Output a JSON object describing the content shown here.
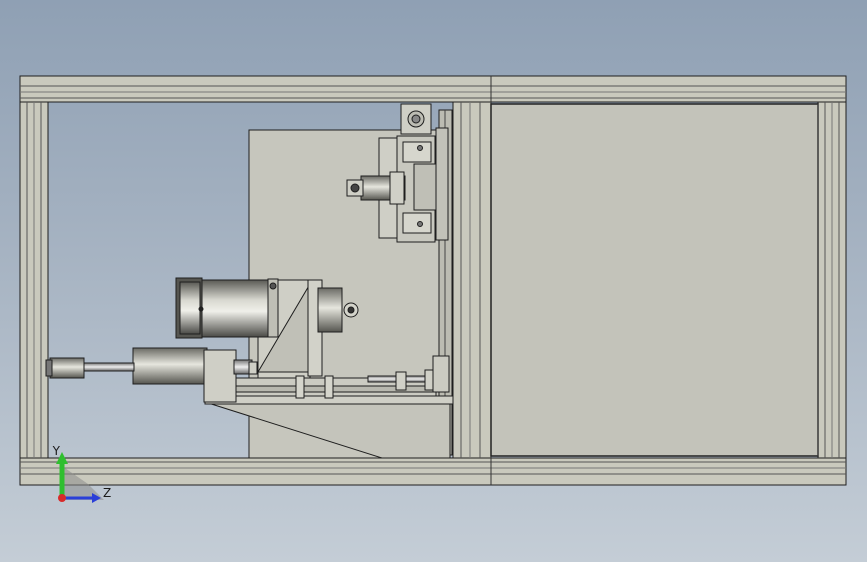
{
  "viewport": {
    "background_top": "#8fa0b4",
    "background_bottom": "#c4cdd6"
  },
  "model": {
    "frame_color": "#c9c9bd",
    "panel_color": "#c5c5bc",
    "part_color": "#cfcfc6",
    "edge_color": "#1e1e1e"
  },
  "triad": {
    "y_label": "Y",
    "z_label": "Z",
    "y_color": "#2fbf2f",
    "z_color": "#2a3fd8",
    "origin_color": "#d82a2a"
  }
}
